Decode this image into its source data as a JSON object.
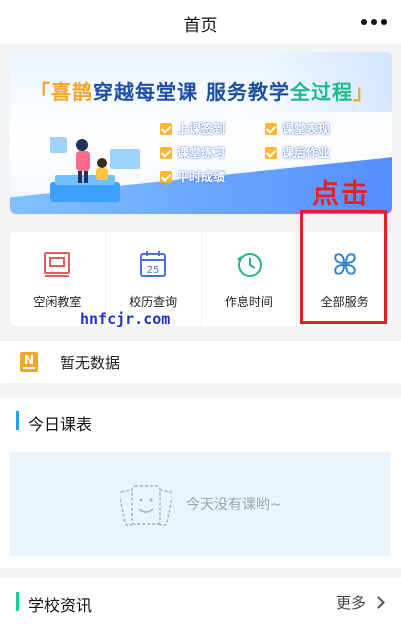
{
  "titlebar": {
    "title": "首页",
    "more_icon": "more-dots-icon"
  },
  "banner": {
    "bracket_open": "「",
    "highlight1": "喜鹊",
    "mid": "穿越每堂课 服务教学",
    "highlight2": "全过程",
    "bracket_close": "」",
    "features": [
      "上课签到",
      "课堂表现",
      "课堂练习",
      "课后作业",
      "平时成绩"
    ]
  },
  "annotation": {
    "label": "点击"
  },
  "services": [
    {
      "label": "空闲教室",
      "icon": "classroom-icon"
    },
    {
      "label": "校历查询",
      "icon": "calendar-icon",
      "day": "25"
    },
    {
      "label": "作息时间",
      "icon": "clock-icon"
    },
    {
      "label": "全部服务",
      "icon": "grid-services-icon"
    }
  ],
  "watermark": "hnfcjr.com",
  "notice": {
    "icon_letter": "N",
    "text": "暂无数据"
  },
  "schedule": {
    "title": "今日课表",
    "empty_text": "今天没有课哟~"
  },
  "news": {
    "title": "学校资讯",
    "more": "更多"
  },
  "colors": {
    "accent_blue": "#1aa3ff",
    "accent_green": "#1fcf9a",
    "annotation_red": "#e02222",
    "notice_orange": "#f2a629"
  }
}
